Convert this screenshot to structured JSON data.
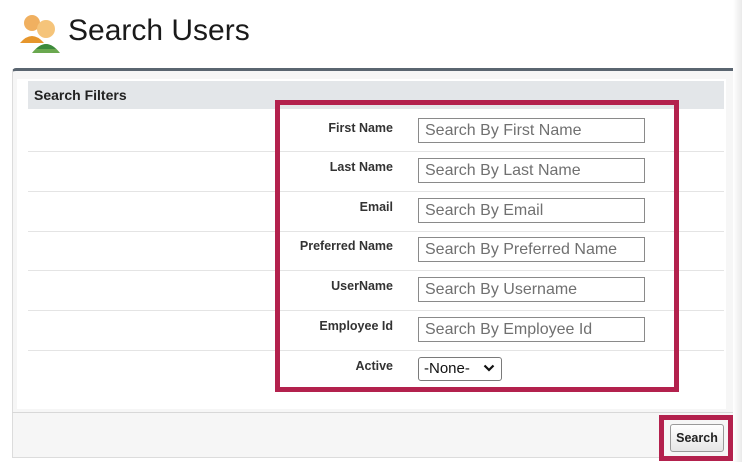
{
  "header": {
    "title": "Search Users",
    "icon": "users-icon"
  },
  "filters": {
    "section_title": "Search Filters",
    "fields": [
      {
        "label": "First Name",
        "placeholder": "Search By First Name"
      },
      {
        "label": "Last Name",
        "placeholder": "Search By Last Name"
      },
      {
        "label": "Email",
        "placeholder": "Search By Email"
      },
      {
        "label": "Preferred Name",
        "placeholder": "Search By Preferred Name"
      },
      {
        "label": "UserName",
        "placeholder": "Search By Username"
      },
      {
        "label": "Employee Id",
        "placeholder": "Search By Employee Id"
      }
    ],
    "active": {
      "label": "Active",
      "selected": "-None-"
    }
  },
  "actions": {
    "search_label": "Search"
  },
  "colors": {
    "highlight": "#b3214d",
    "section_header_bg": "#e3e6e9",
    "panel_top_border": "#5a6570"
  }
}
